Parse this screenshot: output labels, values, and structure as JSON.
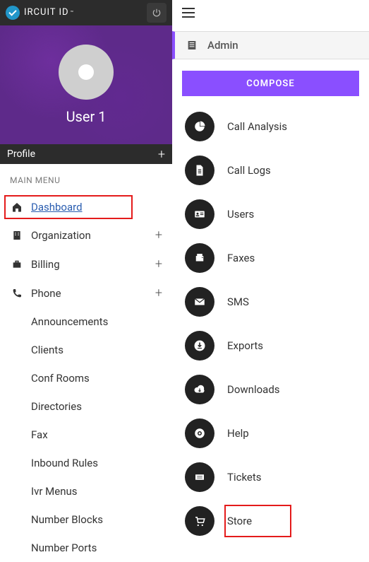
{
  "brand": "IRCUIT ID",
  "brand_tm": "™",
  "profile": {
    "username": "User 1",
    "bar_label": "Profile"
  },
  "main_menu_label": "MAIN MENU",
  "nav": {
    "dashboard": "Dashboard",
    "organization": "Organization",
    "billing": "Billing",
    "phone": "Phone"
  },
  "phone_sub": [
    "Announcements",
    "Clients",
    "Conf Rooms",
    "Directories",
    "Fax",
    "Inbound Rules",
    "Ivr Menus",
    "Number Blocks",
    "Number Ports"
  ],
  "right": {
    "admin_label": "Admin",
    "compose": "COMPOSE",
    "items": [
      {
        "label": "Call Analysis",
        "icon": "pie"
      },
      {
        "label": "Call Logs",
        "icon": "file"
      },
      {
        "label": "Users",
        "icon": "idcard"
      },
      {
        "label": "Faxes",
        "icon": "fax"
      },
      {
        "label": "SMS",
        "icon": "envelope"
      },
      {
        "label": "Exports",
        "icon": "download-fill"
      },
      {
        "label": "Downloads",
        "icon": "cloud-down"
      },
      {
        "label": "Help",
        "icon": "lifebuoy"
      },
      {
        "label": "Tickets",
        "icon": "ticket"
      },
      {
        "label": "Store",
        "icon": "cart",
        "highlight": true
      }
    ]
  }
}
